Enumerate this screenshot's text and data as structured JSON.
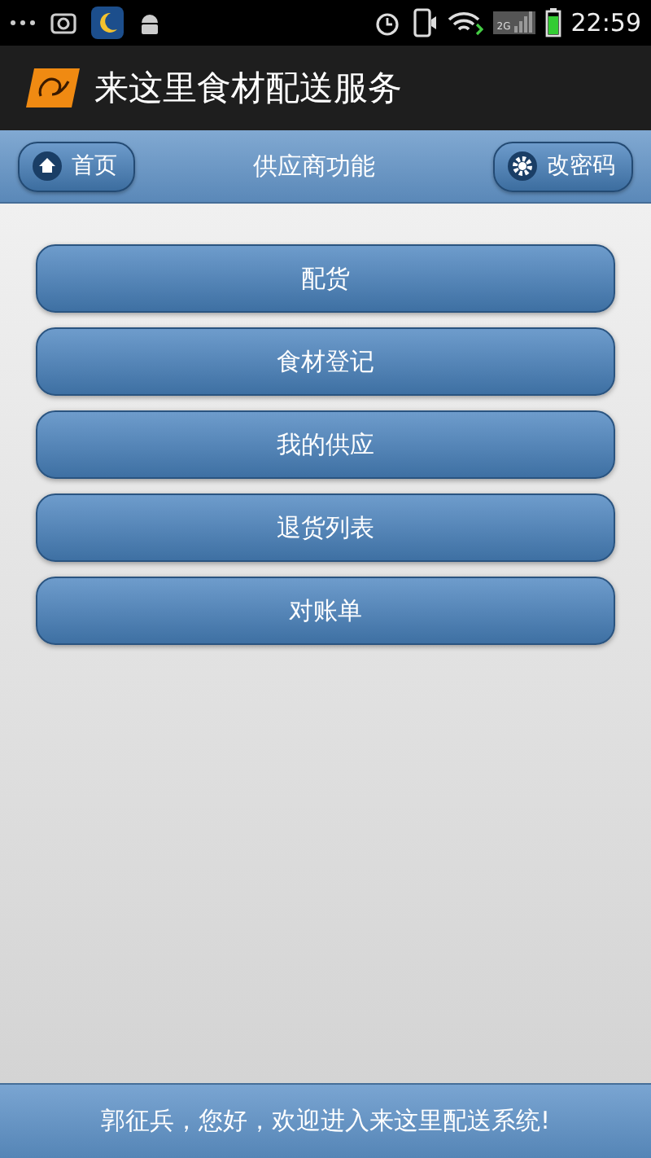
{
  "status_bar": {
    "network_label": "2G",
    "time": "22:59"
  },
  "app_bar": {
    "title": "来这里食材配送服务"
  },
  "header": {
    "left_button": "首页",
    "title": "供应商功能",
    "right_button": "改密码"
  },
  "menu": [
    {
      "label": "配货"
    },
    {
      "label": "食材登记"
    },
    {
      "label": "我的供应"
    },
    {
      "label": "退货列表"
    },
    {
      "label": "对账单"
    }
  ],
  "footer": {
    "message": "郭征兵，您好，欢迎进入来这里配送系统!"
  }
}
